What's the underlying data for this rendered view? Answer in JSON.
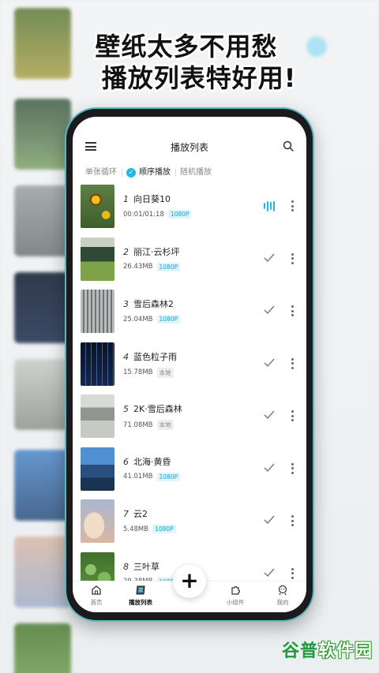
{
  "headline": {
    "line1": "壁纸太多不用愁",
    "line2": "播放列表特好用!"
  },
  "app": {
    "title": "播放列表",
    "modes": [
      {
        "label": "单张循环",
        "active": false
      },
      {
        "label": "顺序播放",
        "active": true
      },
      {
        "label": "随机播放",
        "active": false
      }
    ],
    "items": [
      {
        "index": "1",
        "name": "向日葵10",
        "detail": "00:01/01:18",
        "badge": "1080P",
        "badge_type": "hd",
        "status": "playing-icon"
      },
      {
        "index": "2",
        "name": "丽江·云杉坪",
        "detail": "26.43MB",
        "badge": "1080P",
        "badge_type": "hd",
        "status": "check-icon"
      },
      {
        "index": "3",
        "name": "雪后森林2",
        "detail": "25.04MB",
        "badge": "1080P",
        "badge_type": "hd",
        "status": "check-icon"
      },
      {
        "index": "4",
        "name": "蓝色粒子雨",
        "detail": "15.78MB",
        "badge": "本地",
        "badge_type": "local",
        "status": "check-icon"
      },
      {
        "index": "5",
        "name": "2K·雪后森林",
        "detail": "71.08MB",
        "badge": "本地",
        "badge_type": "local",
        "status": "check-icon"
      },
      {
        "index": "6",
        "name": "北海·黄昏",
        "detail": "41.01MB",
        "badge": "1080P",
        "badge_type": "hd",
        "status": "check-icon"
      },
      {
        "index": "7",
        "name": "云2",
        "detail": "5.48MB",
        "badge": "1080P",
        "badge_type": "hd",
        "status": "check-icon"
      },
      {
        "index": "8",
        "name": "三叶草",
        "detail": "29.38MB",
        "badge": "1080P",
        "badge_type": "hd",
        "status": "check-icon"
      }
    ],
    "tabs": [
      {
        "label": "首页",
        "icon": "home-icon",
        "active": false
      },
      {
        "label": "播放列表",
        "icon": "playlist-icon",
        "active": true
      },
      {
        "label": "小组件",
        "icon": "puzzle-icon",
        "active": false
      },
      {
        "label": "我的",
        "icon": "profile-icon",
        "active": false
      }
    ],
    "fab": "+",
    "accent": "#22b8e6"
  },
  "watermark": {
    "part1": "谷普",
    "part2": "软件园"
  }
}
